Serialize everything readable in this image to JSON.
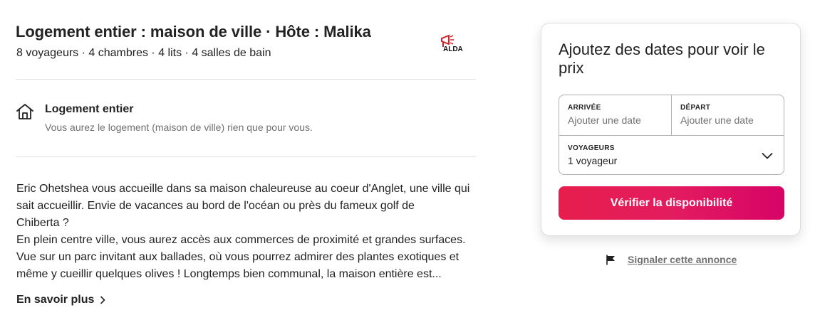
{
  "listing": {
    "title": "Logement entier : maison de ville · Hôte : Malika",
    "subtitle": "8 voyageurs · 4 chambres · 4 lits · 4 salles de bain",
    "host_logo_text": "ALDA"
  },
  "highlight": {
    "icon": "home-icon",
    "title": "Logement entier",
    "description": "Vous aurez le logement (maison de ville) rien que pour vous."
  },
  "description": {
    "lines": [
      "Eric Ohetshea vous accueille dans sa maison chaleureuse au coeur d'Anglet, une ville qui",
      "sait accueillir. Envie de vacances au bord de l'océan ou près du fameux golf de",
      "Chiberta ?",
      "En plein centre ville, vous aurez accès aux commerces de proximité et grandes surfaces.",
      "Vue sur un parc invitant aux ballades, où vous pourrez admirer des plantes exotiques et",
      "même y cueillir quelques olives ! Longtemps bien communal, la maison entière est..."
    ],
    "more_label": "En savoir plus"
  },
  "booking": {
    "title": "Ajoutez des dates pour voir le prix",
    "checkin_label": "ARRIVÉE",
    "checkin_placeholder": "Ajouter une date",
    "checkout_label": "DÉPART",
    "checkout_placeholder": "Ajouter une date",
    "guests_label": "VOYAGEURS",
    "guests_value": "1 voyageur",
    "cta_label": "Vérifier la disponibilité",
    "cta_color": "#e31c5f"
  },
  "report": {
    "icon": "flag-icon",
    "label": "Signaler cette annonce"
  },
  "colors": {
    "text": "#222222",
    "muted": "#717171",
    "border": "#b0b0b0",
    "divider": "#e2e2e2",
    "brand": "#e31c5f"
  }
}
